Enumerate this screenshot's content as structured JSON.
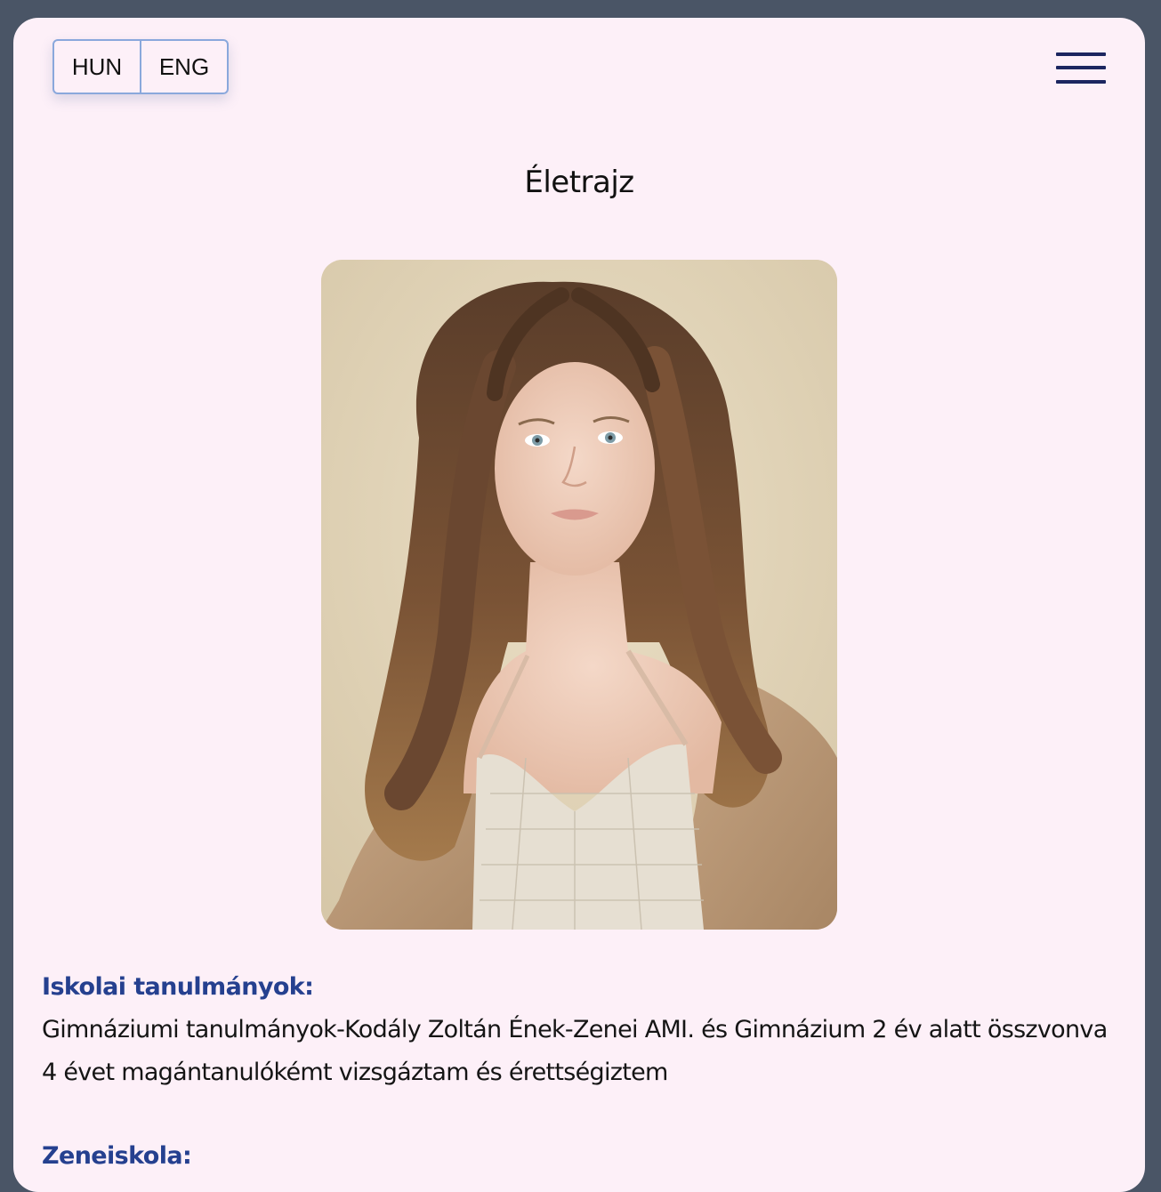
{
  "language_switch": {
    "options": [
      "HUN",
      "ENG"
    ]
  },
  "menu": {
    "icon": "hamburger-menu-icon"
  },
  "page": {
    "title": "Életrajz"
  },
  "portrait": {
    "subject": "portrait photo"
  },
  "sections": [
    {
      "heading": "Iskolai tanulmányok:",
      "body": "Gimnáziumi tanulmányok-Kodály Zoltán Ének-Zenei AMI. és Gimnázium 2 év alatt összvonva 4 évet magántanulókémt vizsgáztam és érettségiztem"
    },
    {
      "heading": "Zeneiskola:",
      "body": ""
    }
  ],
  "colors": {
    "page_background": "#4a5566",
    "card_background": "#fdf0f8",
    "heading_accent": "#25408f",
    "menu_icon": "#1c2660",
    "switch_border": "#8aa8dc"
  }
}
